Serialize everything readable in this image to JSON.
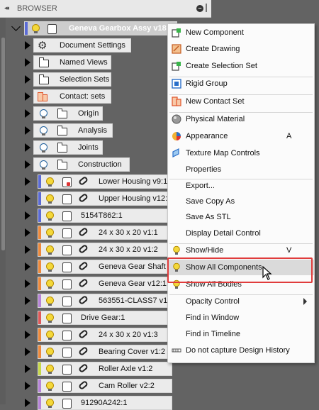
{
  "browser": {
    "title": "BROWSER",
    "collapse_glyph": "◂◂",
    "min_glyph": "–",
    "root": {
      "label": "Geneva Gearbox Assy v18"
    },
    "items": [
      {
        "label": "Document Settings",
        "icon": "gear-icon"
      },
      {
        "label": "Named Views",
        "icon": "folder-icon"
      },
      {
        "label": "Selection Sets",
        "icon": "folder-icon"
      },
      {
        "label": "Contact: sets",
        "icon": "contact-set-icon"
      },
      {
        "label": "Origin",
        "icon": "folder-icon"
      },
      {
        "label": "Analysis",
        "icon": "folder-icon"
      },
      {
        "label": "Joints",
        "icon": "folder-icon"
      },
      {
        "label": "Construction",
        "icon": "folder-icon"
      },
      {
        "label": "Lower Housing v9:1",
        "color": "#5b6bd6"
      },
      {
        "label": "Upper Housing v12:1",
        "color": "#5b6bd6"
      },
      {
        "label": "5154T862:1",
        "color": "#5b6bd6"
      },
      {
        "label": "24 x 30 x 20 v1:1",
        "color": "#ee8a3c"
      },
      {
        "label": "24 x 30 x 20 v1:2",
        "color": "#ee8a3c"
      },
      {
        "label": "Geneva Gear Shaft",
        "color": "#ee8a3c"
      },
      {
        "label": "Geneva Gear v12:1",
        "color": "#ee8a3c"
      },
      {
        "label": "563551-CLASS7 v1",
        "color": "#b684d8"
      },
      {
        "label": "Drive Gear:1",
        "color": "#e05a5a"
      },
      {
        "label": "24 x 30 x 20 v1:3",
        "color": "#ee8a3c"
      },
      {
        "label": "Bearing Cover v1:2",
        "color": "#ee8a3c"
      },
      {
        "label": "Roller Axle v1:2",
        "color": "#c7d94a"
      },
      {
        "label": "Cam Roller v2:2",
        "color": "#b684d8"
      },
      {
        "label": "91290A242:1",
        "color": "#b684d8"
      }
    ]
  },
  "context_menu": {
    "items": [
      {
        "label": "New Component",
        "icon": "new-component-icon",
        "shortcut": ""
      },
      {
        "label": "Create Drawing",
        "icon": "create-drawing-icon",
        "shortcut": ""
      },
      {
        "label": "Create Selection Set",
        "icon": "selection-set-icon",
        "shortcut": ""
      },
      {
        "label": "Rigid Group",
        "icon": "rigid-group-icon",
        "shortcut": ""
      },
      {
        "label": "New Contact Set",
        "icon": "contact-set-icon",
        "shortcut": ""
      },
      {
        "label": "Physical Material",
        "icon": "physical-material-icon",
        "shortcut": ""
      },
      {
        "label": "Appearance",
        "icon": "appearance-icon",
        "shortcut": "A"
      },
      {
        "label": "Texture Map Controls",
        "icon": "texture-map-icon",
        "shortcut": ""
      },
      {
        "label": "Properties",
        "icon": "",
        "shortcut": ""
      },
      {
        "label": "Export...",
        "icon": "",
        "shortcut": ""
      },
      {
        "label": "Save Copy As",
        "icon": "",
        "shortcut": ""
      },
      {
        "label": "Save As STL",
        "icon": "",
        "shortcut": ""
      },
      {
        "label": "Display Detail Control",
        "icon": "",
        "shortcut": ""
      },
      {
        "label": "Show/Hide",
        "icon": "lightbulb-icon",
        "shortcut": "V"
      },
      {
        "label": "Show All Components",
        "icon": "lightbulb-icon",
        "shortcut": ""
      },
      {
        "label": "Show All Bodies",
        "icon": "lightbulb-icon",
        "shortcut": ""
      },
      {
        "label": "Opacity Control",
        "icon": "",
        "shortcut": "",
        "submenu": true
      },
      {
        "label": "Find in Window",
        "icon": "",
        "shortcut": ""
      },
      {
        "label": "Find in Timeline",
        "icon": "",
        "shortcut": ""
      },
      {
        "label": "Do not capture Design History",
        "icon": "design-history-icon",
        "shortcut": ""
      }
    ],
    "highlighted": "Show All Components"
  },
  "colors": {
    "highlight_outline": "#e03c3c",
    "background": "#636363"
  }
}
